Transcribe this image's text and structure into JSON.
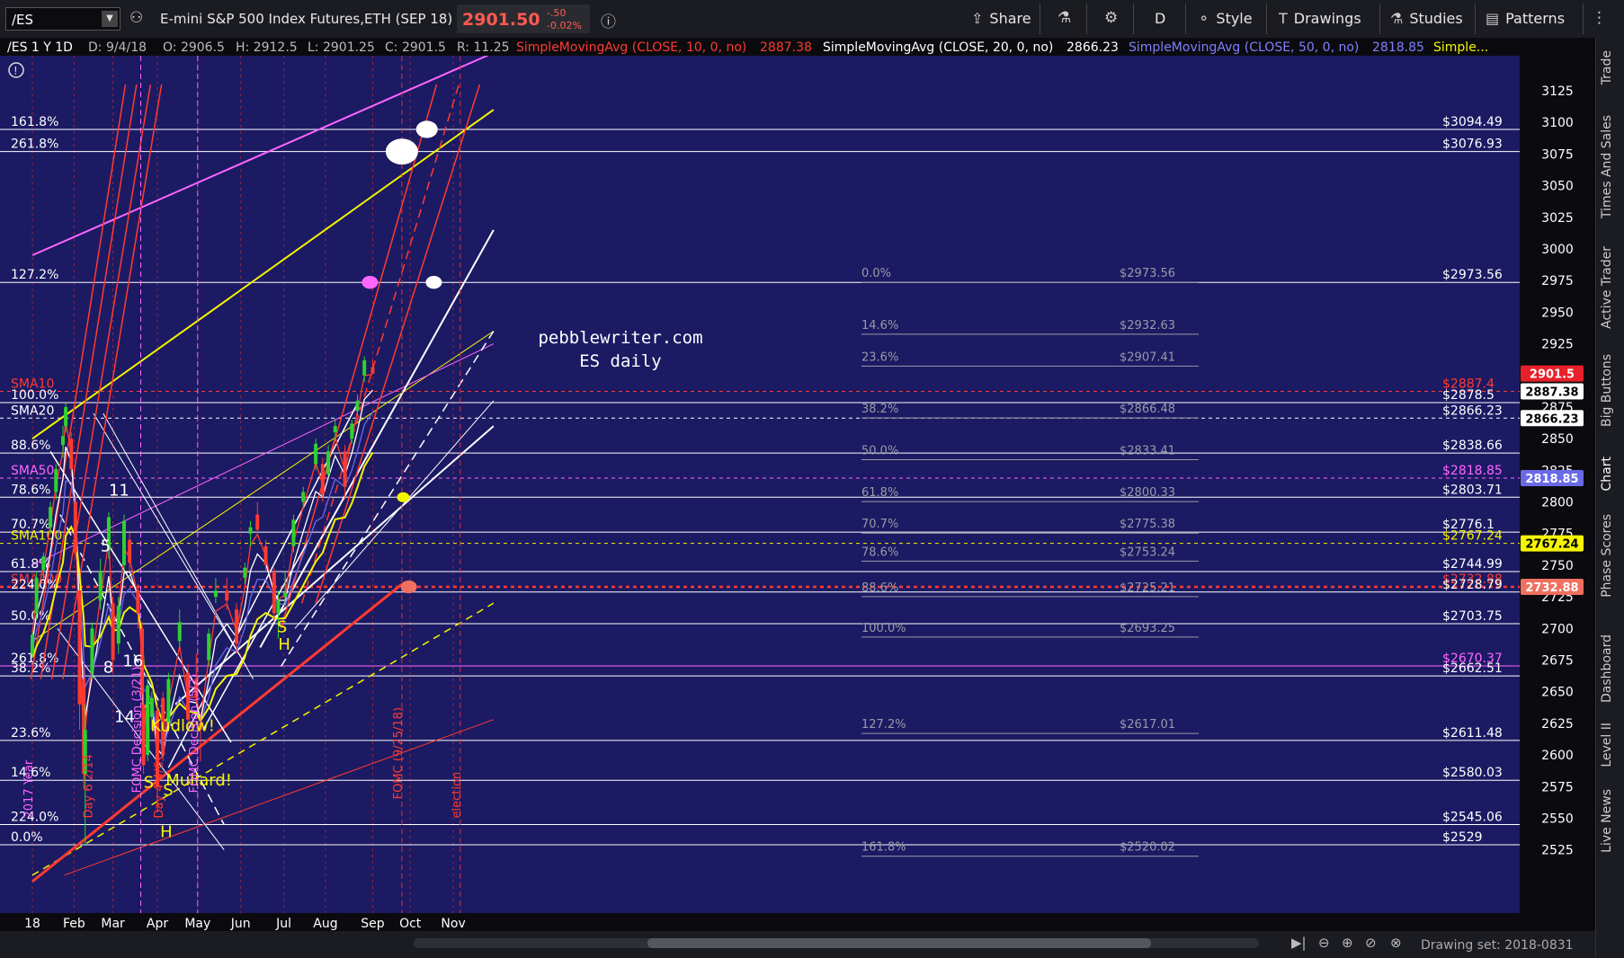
{
  "toolbar": {
    "symbol": "/ES",
    "description": "E-mini S&P 500 Index Futures,ETH (SEP 18)",
    "last_price": "2901.50",
    "change": "-.50",
    "change_pct": "-0.02%",
    "share": "Share",
    "period": "D",
    "style": "Style",
    "drawings": "Drawings",
    "studies": "Studies",
    "patterns": "Patterns"
  },
  "sidebar": {
    "tabs": [
      "Trade",
      "Times And Sales",
      "Active Trader",
      "Big Buttons",
      "Chart",
      "Phase Scores",
      "Dashboard",
      "Level II",
      "Live News"
    ]
  },
  "bottom": {
    "drawing_set": "Drawing set: 2018-0831"
  },
  "header": {
    "info": "/ES 1 Y 1D",
    "date": "D: 9/4/18",
    "open": "O: 2906.5",
    "high": "H: 2912.5",
    "low": "L: 2901.25",
    "close": "C: 2901.5",
    "range": "R: 11.25",
    "sma10": "SimpleMovingAvg (CLOSE, 10, 0, no)",
    "sma10_val": "2887.38",
    "sma20": "SimpleMovingAvg (CLOSE, 20, 0, no)",
    "sma20_val": "2866.23",
    "sma50": "SimpleMovingAvg (CLOSE, 50, 0, no)",
    "sma50_val": "2818.85",
    "more": "Simple..."
  },
  "chart_data": {
    "type": "candlestick",
    "title": "pebblewriter.com",
    "subtitle": "ES daily",
    "ylim": [
      2505,
      3150
    ],
    "y_ticks": [
      2525,
      2550,
      2575,
      2600,
      2625,
      2650,
      2675,
      2700,
      2725,
      2750,
      2775,
      2800,
      2825,
      2850,
      2875,
      2900,
      2925,
      2950,
      2975,
      3000,
      3025,
      3050,
      3075,
      3100,
      3125
    ],
    "x_labels": [
      {
        "label": "18",
        "date": "2018-01-02"
      },
      {
        "label": "Feb",
        "date": "2018-02-01"
      },
      {
        "label": "Mar",
        "date": "2018-03-01"
      },
      {
        "label": "Apr",
        "date": "2018-04-02"
      },
      {
        "label": "May",
        "date": "2018-05-01"
      },
      {
        "label": "Jun",
        "date": "2018-06-01"
      },
      {
        "label": "Jul",
        "date": "2018-07-02"
      },
      {
        "label": "Aug",
        "date": "2018-08-01"
      },
      {
        "label": "Sep",
        "date": "2018-09-04"
      },
      {
        "label": "Oct",
        "date": "2018-10-01"
      },
      {
        "label": "Nov",
        "date": "2018-11-01"
      }
    ],
    "price_axis_badges": [
      {
        "label": "2901.5",
        "color": "#e8202a",
        "value": 2901.5
      },
      {
        "label": "2887.38",
        "color": "#ffffff",
        "value": 2887.38
      },
      {
        "label": "2866.23",
        "color": "#ffffff",
        "value": 2866.23
      },
      {
        "label": "2818.85",
        "color": "#6a6ae8",
        "value": 2818.85
      },
      {
        "label": "2767.24",
        "color": "#f5f500",
        "value": 2767.24
      },
      {
        "label": "2732.88",
        "color": "#f07060",
        "value": 2732.88
      }
    ],
    "levels": [
      {
        "label": "$3094.49",
        "value": 3094.49,
        "color": "#ffffff",
        "fib": "161.8%"
      },
      {
        "label": "$3076.93",
        "value": 3076.93,
        "color": "#ffffff",
        "fib": "261.8%"
      },
      {
        "label": "$2973.56",
        "value": 2973.56,
        "color": "#ffffff",
        "fib": "127.2%"
      },
      {
        "label": "$2887.4",
        "value": 2887.4,
        "color": "#ff3b30",
        "fib": "SMA10"
      },
      {
        "label": "$2878.5",
        "value": 2878.5,
        "color": "#ffffff",
        "fib": "100.0%"
      },
      {
        "label": "$2866.23",
        "value": 2866.23,
        "color": "#ffffff",
        "fib": "SMA20"
      },
      {
        "label": "$2838.66",
        "value": 2838.66,
        "color": "#ffffff",
        "fib": "88.6%"
      },
      {
        "label": "$2818.85",
        "value": 2818.85,
        "color": "#ff66ff",
        "fib": "SMA50"
      },
      {
        "label": "$2803.71",
        "value": 2803.71,
        "color": "#ffffff",
        "fib": "78.6%"
      },
      {
        "label": "$2776.1",
        "value": 2776.1,
        "color": "#ffffff",
        "fib": "70.7%"
      },
      {
        "label": "$2767.24",
        "value": 2767.24,
        "color": "#f5f500",
        "fib": "SMA100"
      },
      {
        "label": "$2744.99",
        "value": 2744.99,
        "color": "#ffffff",
        "fib": "61.8%"
      },
      {
        "label": "$2732.88",
        "value": 2732.88,
        "color": "#ff3b30",
        "fib": "SMA200"
      },
      {
        "label": "$2728.79",
        "value": 2728.79,
        "color": "#ffffff",
        "fib": "224.0%"
      },
      {
        "label": "$2703.75",
        "value": 2703.75,
        "color": "#ffffff",
        "fib": "50.0%"
      },
      {
        "label": "$2670.37",
        "value": 2670.37,
        "color": "#ff66ff",
        "fib": "261.8%"
      },
      {
        "label": "$2662.51",
        "value": 2662.51,
        "color": "#ffffff",
        "fib": "38.2%"
      },
      {
        "label": "$2611.48",
        "value": 2611.48,
        "color": "#ffffff",
        "fib": "23.6%"
      },
      {
        "label": "$2580.03",
        "value": 2580.03,
        "color": "#ffffff",
        "fib": "14.6%"
      },
      {
        "label": "$2545.06",
        "value": 2545.06,
        "color": "#ffffff",
        "fib": "224.0%"
      },
      {
        "label": "$2529",
        "value": 2529,
        "color": "#ffffff",
        "fib": "0.0%"
      }
    ],
    "fib_inner": [
      {
        "pct": "0.0%",
        "label": "$2973.56",
        "value": 2973.56
      },
      {
        "pct": "14.6%",
        "label": "$2932.63",
        "value": 2932.63
      },
      {
        "pct": "23.6%",
        "label": "$2907.41",
        "value": 2907.41
      },
      {
        "pct": "38.2%",
        "label": "$2866.48",
        "value": 2866.48
      },
      {
        "pct": "50.0%",
        "label": "$2833.41",
        "value": 2833.41
      },
      {
        "pct": "61.8%",
        "label": "$2800.33",
        "value": 2800.33
      },
      {
        "pct": "70.7%",
        "label": "$2775.38",
        "value": 2775.38
      },
      {
        "pct": "78.6%",
        "label": "$2753.24",
        "value": 2753.24
      },
      {
        "pct": "88.6%",
        "label": "$2725.21",
        "value": 2725.21
      },
      {
        "pct": "100.0%",
        "label": "$2693.25",
        "value": 2693.25
      },
      {
        "pct": "127.2%",
        "label": "$2617.01",
        "value": 2617.01
      },
      {
        "pct": "161.8%",
        "label": "$2520.02",
        "value": 2520.02
      }
    ],
    "annotations": [
      {
        "text": "11",
        "date": "2018-02-26",
        "value": 2805
      },
      {
        "text": "5",
        "date": "2018-02-20",
        "value": 2761
      },
      {
        "text": "8",
        "date": "2018-02-22",
        "value": 2665
      },
      {
        "text": "16",
        "date": "2018-03-08",
        "value": 2670
      },
      {
        "text": "14",
        "date": "2018-03-02",
        "value": 2626
      },
      {
        "text": "S",
        "date": "2018-03-23",
        "value": 2574
      },
      {
        "text": "S",
        "date": "2018-04-06",
        "value": 2568
      },
      {
        "text": "H",
        "date": "2018-04-04",
        "value": 2535
      },
      {
        "text": "Kudlow!",
        "date": "2018-03-28",
        "value": 2619
      },
      {
        "text": "Mullard!",
        "date": "2018-04-08",
        "value": 2576
      },
      {
        "text": "S",
        "date": "2018-06-27",
        "value": 2697
      },
      {
        "text": "H",
        "date": "2018-06-28",
        "value": 2683
      },
      {
        "text": "FOMC Decision (3/21)",
        "date": "2018-03-21",
        "value": 2570
      },
      {
        "text": "FOMC Decision (5/2)",
        "date": "2018-05-01",
        "value": 2570
      },
      {
        "text": "FOMC (9/25/18)",
        "date": "2018-09-25",
        "value": 2565
      },
      {
        "text": "Day 6 2/14",
        "date": "2018-02-14",
        "value": 2550
      },
      {
        "text": "Day 4 4/6",
        "date": "2018-04-06",
        "value": 2550
      },
      {
        "text": "election",
        "date": "2018-11-06",
        "value": 2550
      },
      {
        "text": "2017 Year",
        "date": "2018-01-02",
        "value": 2550
      }
    ],
    "candles": [
      {
        "d": "2018-01-02",
        "o": 2680,
        "h": 2698,
        "l": 2677,
        "c": 2695
      },
      {
        "d": "2018-01-05",
        "o": 2712,
        "h": 2745,
        "l": 2707,
        "c": 2740
      },
      {
        "d": "2018-01-10",
        "o": 2746,
        "h": 2760,
        "l": 2740,
        "c": 2757
      },
      {
        "d": "2018-01-15",
        "o": 2780,
        "h": 2800,
        "l": 2775,
        "c": 2796
      },
      {
        "d": "2018-01-19",
        "o": 2808,
        "h": 2830,
        "l": 2802,
        "c": 2826
      },
      {
        "d": "2018-01-24",
        "o": 2845,
        "h": 2860,
        "l": 2835,
        "c": 2852
      },
      {
        "d": "2018-01-26",
        "o": 2860,
        "h": 2878,
        "l": 2855,
        "c": 2875
      },
      {
        "d": "2018-01-30",
        "o": 2850,
        "h": 2855,
        "l": 2820,
        "c": 2826
      },
      {
        "d": "2018-02-02",
        "o": 2800,
        "h": 2806,
        "l": 2755,
        "c": 2760
      },
      {
        "d": "2018-02-05",
        "o": 2730,
        "h": 2735,
        "l": 2620,
        "c": 2640
      },
      {
        "d": "2018-02-08",
        "o": 2660,
        "h": 2670,
        "l": 2575,
        "c": 2585
      },
      {
        "d": "2018-02-09",
        "o": 2585,
        "h": 2640,
        "l": 2529,
        "c": 2620
      },
      {
        "d": "2018-02-14",
        "o": 2665,
        "h": 2705,
        "l": 2660,
        "c": 2700
      },
      {
        "d": "2018-02-20",
        "o": 2722,
        "h": 2755,
        "l": 2715,
        "c": 2745
      },
      {
        "d": "2018-02-26",
        "o": 2762,
        "h": 2792,
        "l": 2755,
        "c": 2788
      },
      {
        "d": "2018-03-01",
        "o": 2720,
        "h": 2725,
        "l": 2665,
        "c": 2675
      },
      {
        "d": "2018-03-05",
        "o": 2688,
        "h": 2725,
        "l": 2680,
        "c": 2718
      },
      {
        "d": "2018-03-09",
        "o": 2750,
        "h": 2790,
        "l": 2745,
        "c": 2785
      },
      {
        "d": "2018-03-13",
        "o": 2770,
        "h": 2776,
        "l": 2745,
        "c": 2752
      },
      {
        "d": "2018-03-19",
        "o": 2730,
        "h": 2735,
        "l": 2700,
        "c": 2712
      },
      {
        "d": "2018-03-22",
        "o": 2700,
        "h": 2705,
        "l": 2640,
        "c": 2648
      },
      {
        "d": "2018-03-23",
        "o": 2640,
        "h": 2648,
        "l": 2585,
        "c": 2592
      },
      {
        "d": "2018-03-26",
        "o": 2600,
        "h": 2660,
        "l": 2595,
        "c": 2655
      },
      {
        "d": "2018-03-29",
        "o": 2630,
        "h": 2650,
        "l": 2620,
        "c": 2645
      },
      {
        "d": "2018-04-02",
        "o": 2635,
        "h": 2640,
        "l": 2555,
        "c": 2575
      },
      {
        "d": "2018-04-06",
        "o": 2645,
        "h": 2650,
        "l": 2595,
        "c": 2600
      },
      {
        "d": "2018-04-10",
        "o": 2625,
        "h": 2665,
        "l": 2620,
        "c": 2660
      },
      {
        "d": "2018-04-18",
        "o": 2690,
        "h": 2715,
        "l": 2685,
        "c": 2705
      },
      {
        "d": "2018-04-24",
        "o": 2665,
        "h": 2672,
        "l": 2618,
        "c": 2628
      },
      {
        "d": "2018-04-30",
        "o": 2660,
        "h": 2680,
        "l": 2640,
        "c": 2646
      },
      {
        "d": "2018-05-03",
        "o": 2625,
        "h": 2632,
        "l": 2595,
        "c": 2620
      },
      {
        "d": "2018-05-09",
        "o": 2675,
        "h": 2700,
        "l": 2670,
        "c": 2696
      },
      {
        "d": "2018-05-14",
        "o": 2725,
        "h": 2740,
        "l": 2720,
        "c": 2730
      },
      {
        "d": "2018-05-22",
        "o": 2730,
        "h": 2740,
        "l": 2715,
        "c": 2722
      },
      {
        "d": "2018-05-29",
        "o": 2715,
        "h": 2720,
        "l": 2680,
        "c": 2688
      },
      {
        "d": "2018-06-04",
        "o": 2740,
        "h": 2752,
        "l": 2735,
        "c": 2748
      },
      {
        "d": "2018-06-08",
        "o": 2775,
        "h": 2785,
        "l": 2765,
        "c": 2780
      },
      {
        "d": "2018-06-13",
        "o": 2790,
        "h": 2800,
        "l": 2775,
        "c": 2778
      },
      {
        "d": "2018-06-19",
        "o": 2765,
        "h": 2770,
        "l": 2745,
        "c": 2750
      },
      {
        "d": "2018-06-25",
        "o": 2745,
        "h": 2748,
        "l": 2705,
        "c": 2712
      },
      {
        "d": "2018-06-28",
        "o": 2712,
        "h": 2730,
        "l": 2692,
        "c": 2722
      },
      {
        "d": "2018-07-03",
        "o": 2725,
        "h": 2745,
        "l": 2718,
        "c": 2728
      },
      {
        "d": "2018-07-09",
        "o": 2765,
        "h": 2790,
        "l": 2760,
        "c": 2786
      },
      {
        "d": "2018-07-16",
        "o": 2800,
        "h": 2812,
        "l": 2795,
        "c": 2808
      },
      {
        "d": "2018-07-25",
        "o": 2830,
        "h": 2850,
        "l": 2825,
        "c": 2846
      },
      {
        "d": "2018-07-30",
        "o": 2830,
        "h": 2835,
        "l": 2800,
        "c": 2806
      },
      {
        "d": "2018-08-03",
        "o": 2822,
        "h": 2845,
        "l": 2820,
        "c": 2840
      },
      {
        "d": "2018-08-08",
        "o": 2855,
        "h": 2866,
        "l": 2848,
        "c": 2860
      },
      {
        "d": "2018-08-15",
        "o": 2840,
        "h": 2845,
        "l": 2802,
        "c": 2812
      },
      {
        "d": "2018-08-20",
        "o": 2850,
        "h": 2865,
        "l": 2846,
        "c": 2862
      },
      {
        "d": "2018-08-24",
        "o": 2872,
        "h": 2885,
        "l": 2868,
        "c": 2880
      },
      {
        "d": "2018-08-29",
        "o": 2900,
        "h": 2915,
        "l": 2895,
        "c": 2912
      },
      {
        "d": "2018-09-04",
        "o": 2906.5,
        "h": 2912.5,
        "l": 2901.25,
        "c": 2901.5
      }
    ],
    "colors": {
      "background": "#1c1a63",
      "up": "#2fd12f",
      "down": "#ff3b30"
    }
  }
}
